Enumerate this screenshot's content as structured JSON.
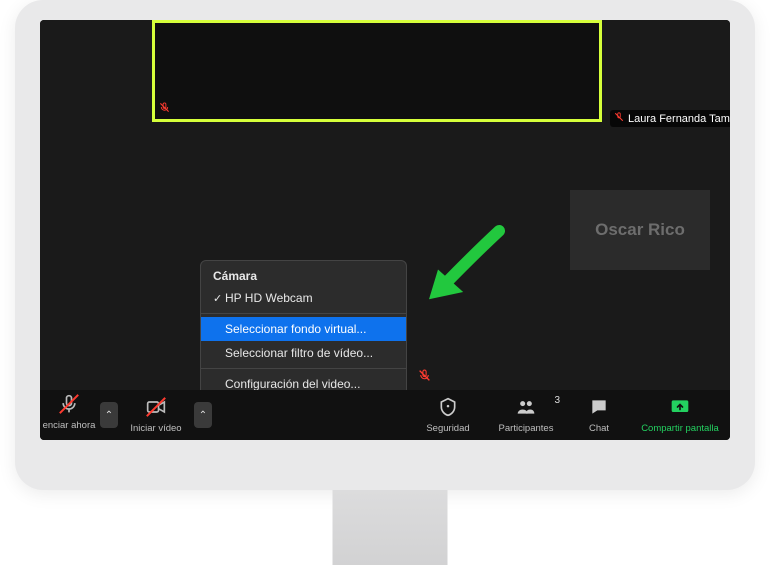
{
  "participants": {
    "pinned_name": "Laura Fernanda Tamayo",
    "tile_name": "Oscar Rico"
  },
  "menu": {
    "section_camera": "Cámara",
    "camera_selected": "HP HD Webcam",
    "option_virtual_bg": "Seleccionar fondo virtual...",
    "option_video_filter": "Seleccionar filtro de vídeo...",
    "option_video_settings": "Configuración del video..."
  },
  "toolbar": {
    "mute_label": "enciar ahora",
    "video_label": "Iniciar vídeo",
    "security_label": "Seguridad",
    "participants_label": "Participantes",
    "participants_count": "3",
    "chat_label": "Chat",
    "share_label": "Compartir pantalla"
  }
}
